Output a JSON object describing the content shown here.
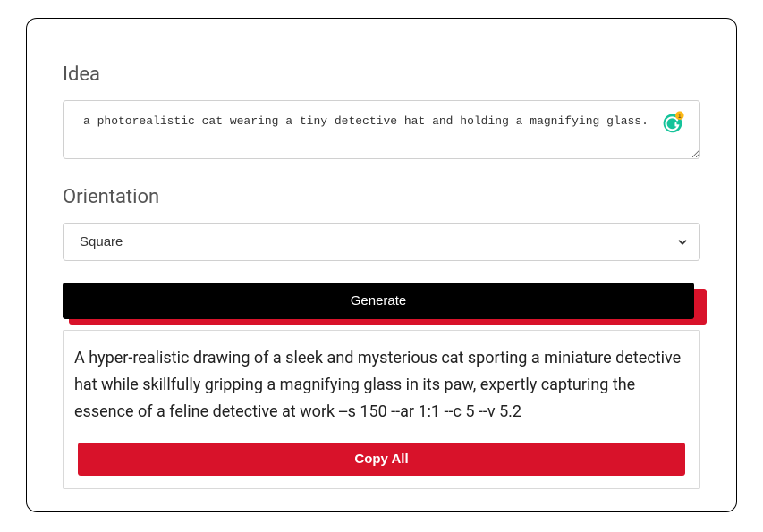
{
  "form": {
    "idea_label": "Idea",
    "idea_value": "a photorealistic cat wearing a tiny detective hat and holding a magnifying glass.",
    "orientation_label": "Orientation",
    "orientation_selected": "Square",
    "generate_label": "Generate"
  },
  "output": {
    "text": "A hyper-realistic drawing of a sleek and mysterious cat sporting a miniature detective hat while skillfully gripping a magnifying glass in its paw, expertly capturing the essence of a feline detective at work --s 150 --ar 1:1 --c 5 --v 5.2",
    "copy_label": "Copy All"
  },
  "grammarly": {
    "badge_count": "1"
  }
}
